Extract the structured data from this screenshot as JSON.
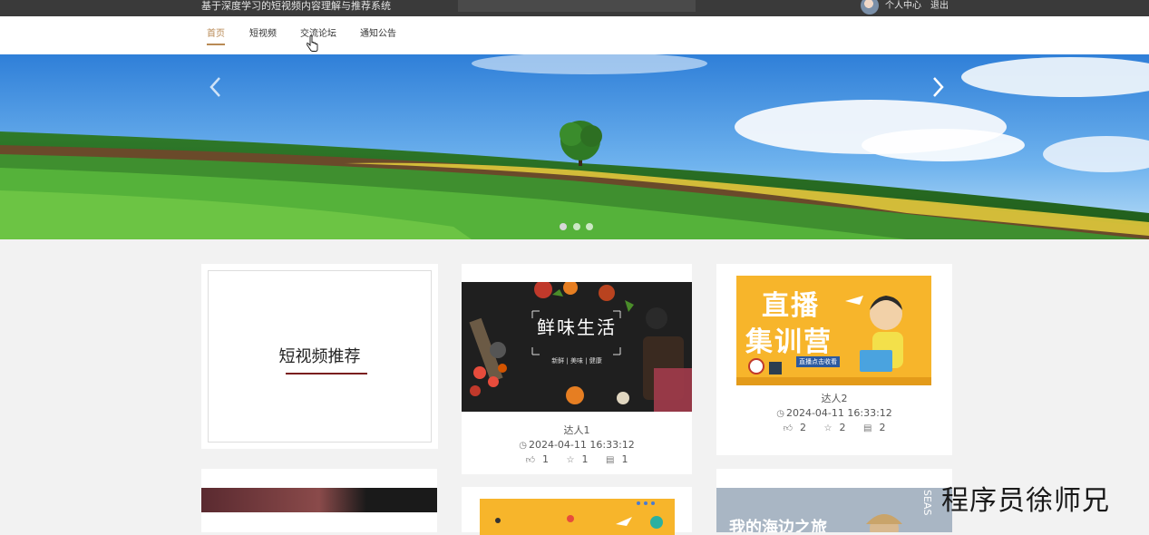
{
  "topbar": {
    "site_title": "基于深度学习的短视频内容理解与推荐系统",
    "user_center": "个人中心",
    "logout": "退出"
  },
  "nav": {
    "items": [
      {
        "label": "首页",
        "active": true
      },
      {
        "label": "短视频",
        "active": false
      },
      {
        "label": "交流论坛",
        "active": false
      },
      {
        "label": "通知公告",
        "active": false
      }
    ]
  },
  "banner": {
    "slide_count": 3,
    "active_slide": 1
  },
  "intro": {
    "title": "短视频推荐"
  },
  "videos": [
    {
      "thumb_title": "鲜味生活",
      "thumb_subtitle": "新鲜 | 美味 | 健康",
      "author": "达人1",
      "time": "2024-04-11 16:33:12",
      "likes": "1",
      "favorites": "1",
      "comments": "1"
    },
    {
      "thumb_title_line1": "直播",
      "thumb_title_line2": "集训营",
      "thumb_badge": "直播点击收看",
      "author": "达人2",
      "time": "2024-04-11 16:33:12",
      "likes": "2",
      "favorites": "2",
      "comments": "2"
    },
    {
      "thumb_title": "我的海边之旅",
      "thumb_side": "SEAS"
    }
  ],
  "watermark": "程序员徐师兄",
  "colors": {
    "topbar": "#3a3a3a",
    "nav_active": "#b98a55",
    "intro_underline": "#7a1e1e",
    "live_card_bg": "#f7b52b"
  }
}
